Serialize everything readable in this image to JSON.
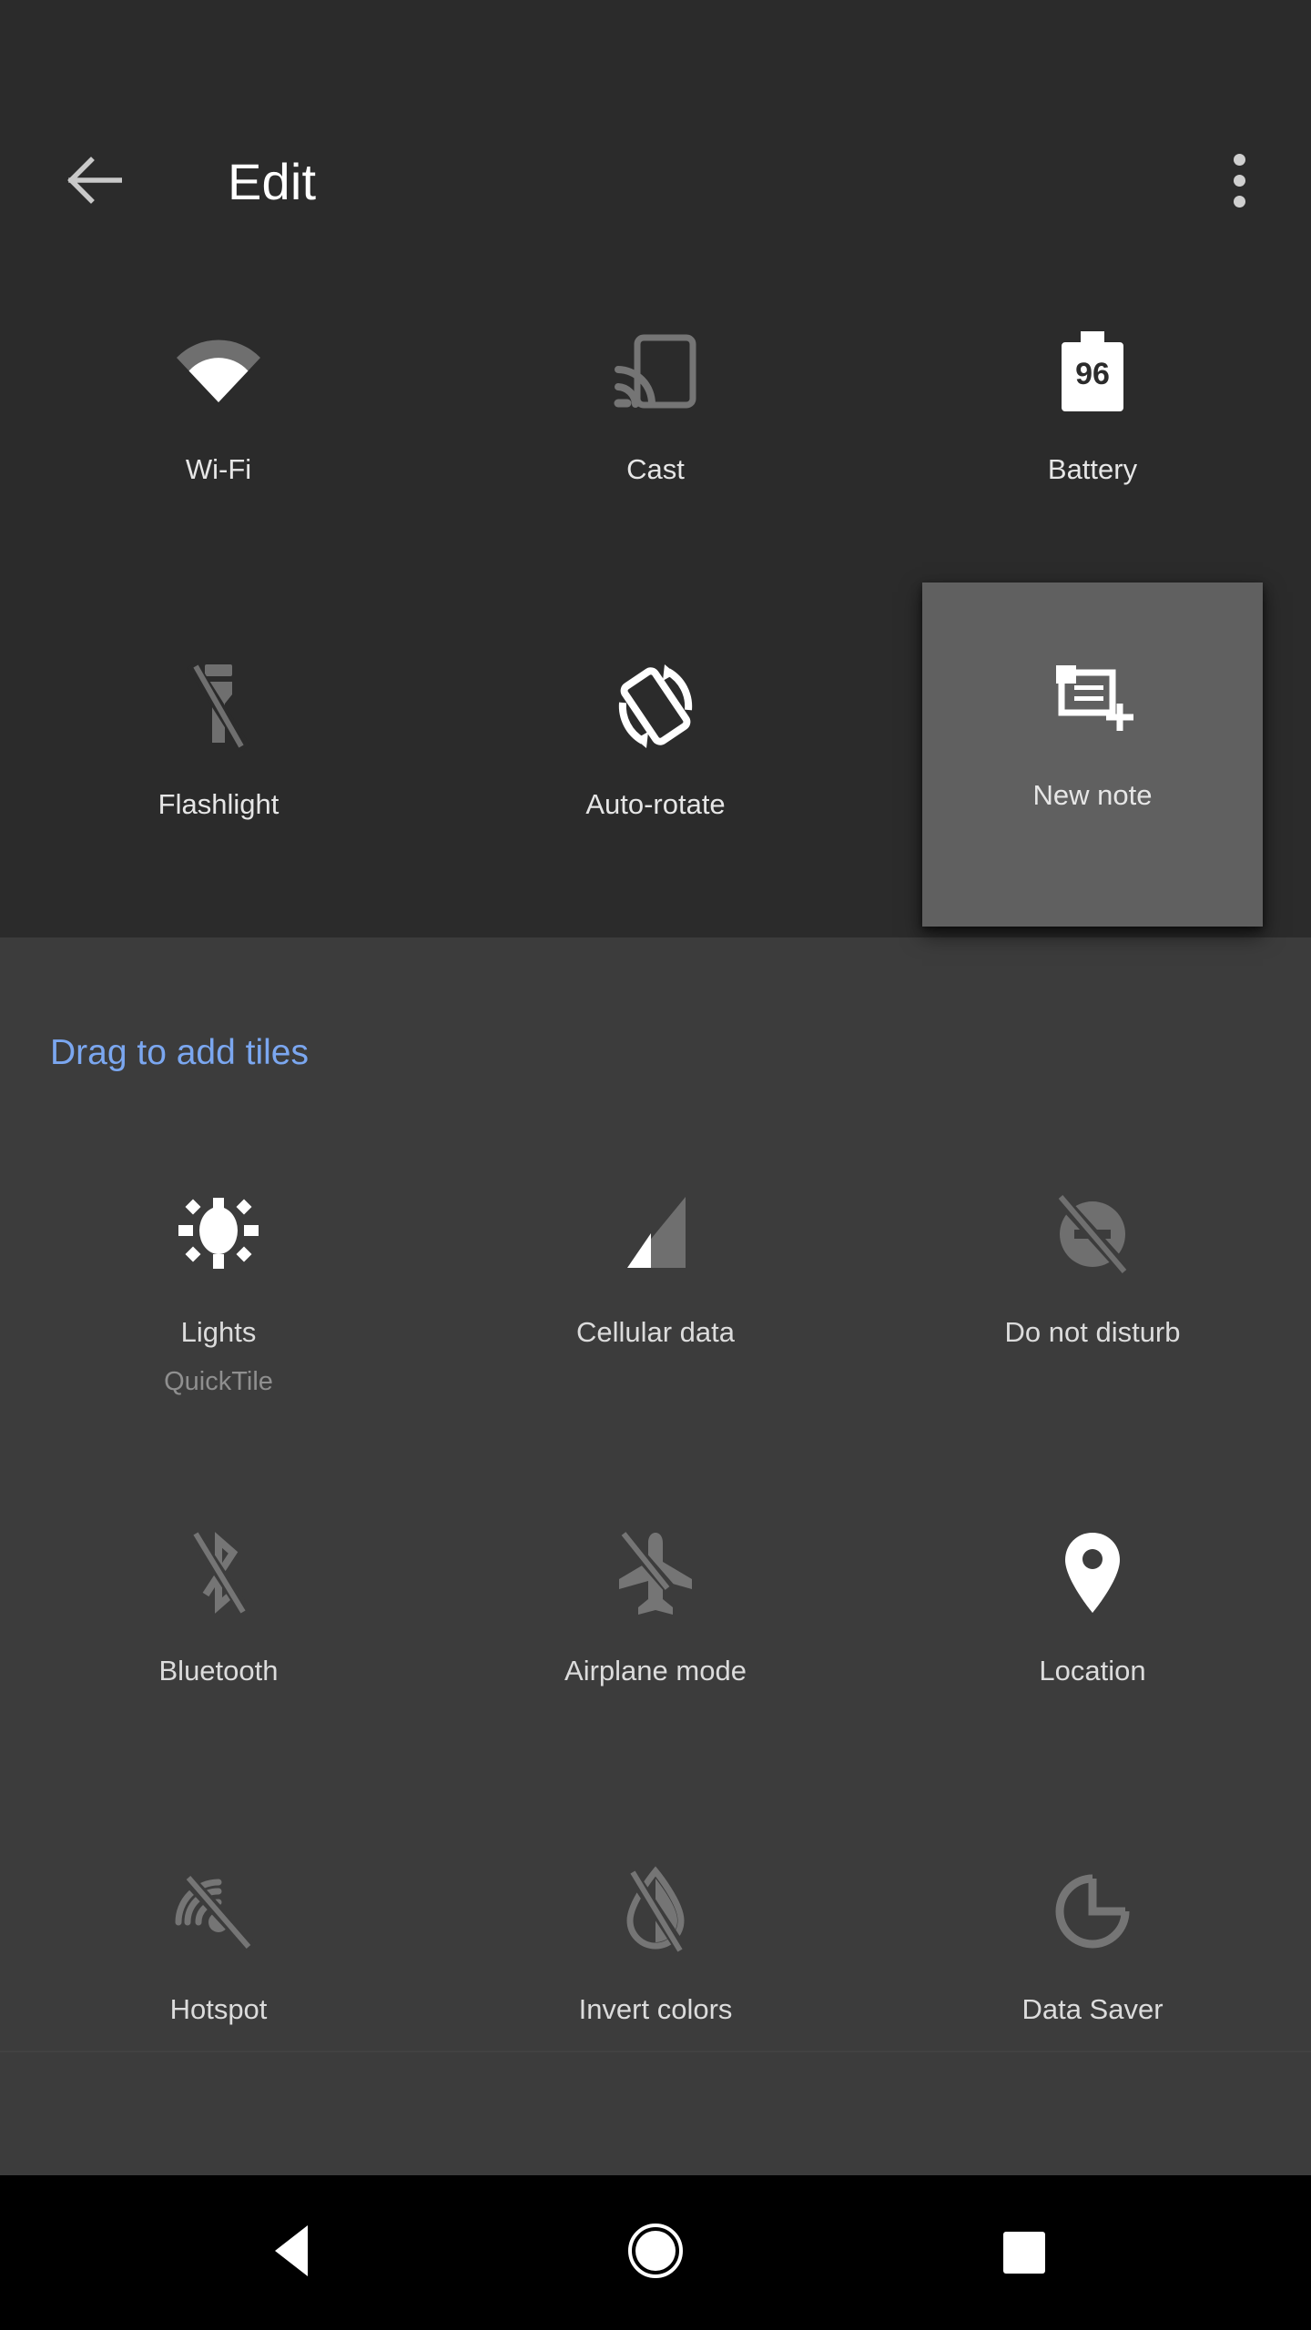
{
  "appbar": {
    "title": "Edit",
    "back_icon": "arrow-back-icon",
    "overflow_icon": "more-vert-icon"
  },
  "active_tiles": {
    "items": [
      {
        "label": "Wi-Fi",
        "icon": "wifi-icon",
        "state": "enabled"
      },
      {
        "label": "Cast",
        "icon": "cast-icon",
        "state": "disabled"
      },
      {
        "label": "Battery",
        "icon": "battery-icon",
        "state": "enabled",
        "badge": "96"
      },
      {
        "label": "Flashlight",
        "icon": "flashlight-off-icon",
        "state": "disabled"
      },
      {
        "label": "Auto-rotate",
        "icon": "auto-rotate-icon",
        "state": "enabled"
      },
      {
        "label": "New note",
        "icon": "new-note-icon",
        "state": "dragging"
      }
    ]
  },
  "add_section": {
    "heading": "Drag to add tiles",
    "heading_color": "#7ba7f0",
    "items": [
      {
        "label": "Lights",
        "sublabel": "QuickTile",
        "icon": "light-bulb-icon",
        "state": "enabled"
      },
      {
        "label": "Cellular data",
        "icon": "cellular-signal-icon",
        "state": "enabled"
      },
      {
        "label": "Do not disturb",
        "icon": "do-not-disturb-off-icon",
        "state": "disabled"
      },
      {
        "label": "Bluetooth",
        "icon": "bluetooth-off-icon",
        "state": "disabled"
      },
      {
        "label": "Airplane mode",
        "icon": "airplane-icon",
        "state": "disabled"
      },
      {
        "label": "Location",
        "icon": "location-pin-icon",
        "state": "enabled"
      },
      {
        "label": "Hotspot",
        "icon": "hotspot-off-icon",
        "state": "disabled"
      },
      {
        "label": "Invert colors",
        "icon": "invert-colors-off-icon",
        "state": "disabled"
      },
      {
        "label": "Data Saver",
        "icon": "data-saver-icon",
        "state": "disabled"
      }
    ]
  },
  "navbar": {
    "back": "nav-back-icon",
    "home": "nav-home-icon",
    "recents": "nav-recents-icon"
  },
  "colors": {
    "accent": "#7ba7f0",
    "panel_top": "#2b2b2b",
    "panel_bottom": "#3c3c3c",
    "tile_dragging": "#606060",
    "icon_enabled": "#ffffff",
    "icon_disabled": "#7d7d7d",
    "label": "#e6e6e6",
    "sublabel": "#8f8f8f",
    "navbar": "#000000"
  }
}
